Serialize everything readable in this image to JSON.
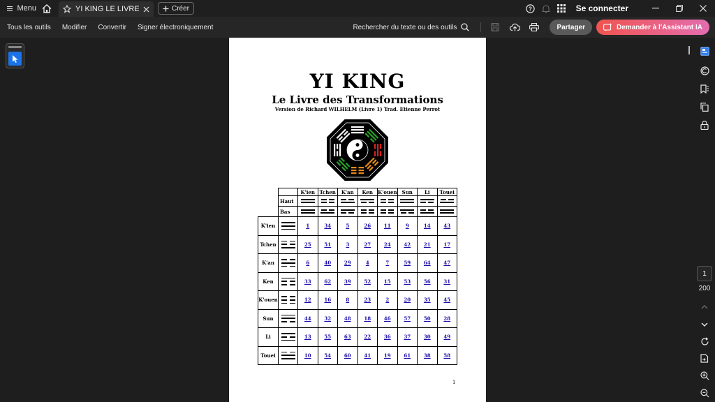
{
  "titlebar": {
    "menu_label": "Menu",
    "tab_title": "YI KING LE LIVRE D...",
    "create_label": "Créer",
    "signin_label": "Se connecter"
  },
  "toolbar": {
    "items": [
      "Tous les outils",
      "Modifier",
      "Convertir",
      "Signer électroniquement"
    ],
    "search_label": "Rechercher du texte ou des outils",
    "share_label": "Partager",
    "ai_label": "Demander à l'Assistant IA"
  },
  "document": {
    "title": "YI KING",
    "subtitle": "Le Livre des Transformations",
    "version": "Version de Richard WILHELM (Livre 1) Trad. Etienne Perrot",
    "page_number": "1",
    "table": {
      "trigrams": [
        "K'ien",
        "Tchen",
        "K'an",
        "Ken",
        "K'ouen",
        "Sun",
        "Li",
        "Touei"
      ],
      "trigram_lines": [
        [
          1,
          1,
          1
        ],
        [
          0,
          0,
          1
        ],
        [
          0,
          1,
          0
        ],
        [
          1,
          0,
          0
        ],
        [
          0,
          0,
          0
        ],
        [
          1,
          1,
          0
        ],
        [
          1,
          0,
          1
        ],
        [
          0,
          1,
          1
        ]
      ],
      "haut_label": "Haut",
      "bas_label": "Bas",
      "rows": [
        [
          "1",
          "34",
          "5",
          "26",
          "11",
          "9",
          "14",
          "43"
        ],
        [
          "25",
          "51",
          "3",
          "27",
          "24",
          "42",
          "21",
          "17"
        ],
        [
          "6",
          "40",
          "29",
          "4",
          "7",
          "59",
          "64",
          "47"
        ],
        [
          "33",
          "62",
          "39",
          "52",
          "15",
          "53",
          "56",
          "31"
        ],
        [
          "12",
          "16",
          "8",
          "23",
          "2",
          "20",
          "35",
          "45"
        ],
        [
          "44",
          "32",
          "48",
          "18",
          "46",
          "57",
          "50",
          "28"
        ],
        [
          "13",
          "55",
          "63",
          "22",
          "36",
          "37",
          "30",
          "49"
        ],
        [
          "10",
          "54",
          "60",
          "41",
          "19",
          "61",
          "38",
          "58"
        ]
      ]
    }
  },
  "navigation": {
    "current_page": "1",
    "total_pages": "200"
  },
  "colors": {
    "ai_gradient_start": "#f0544f",
    "ai_gradient_end": "#e36db0",
    "accent_blue": "#1a73e8",
    "link_blue": "#1a0dab"
  }
}
